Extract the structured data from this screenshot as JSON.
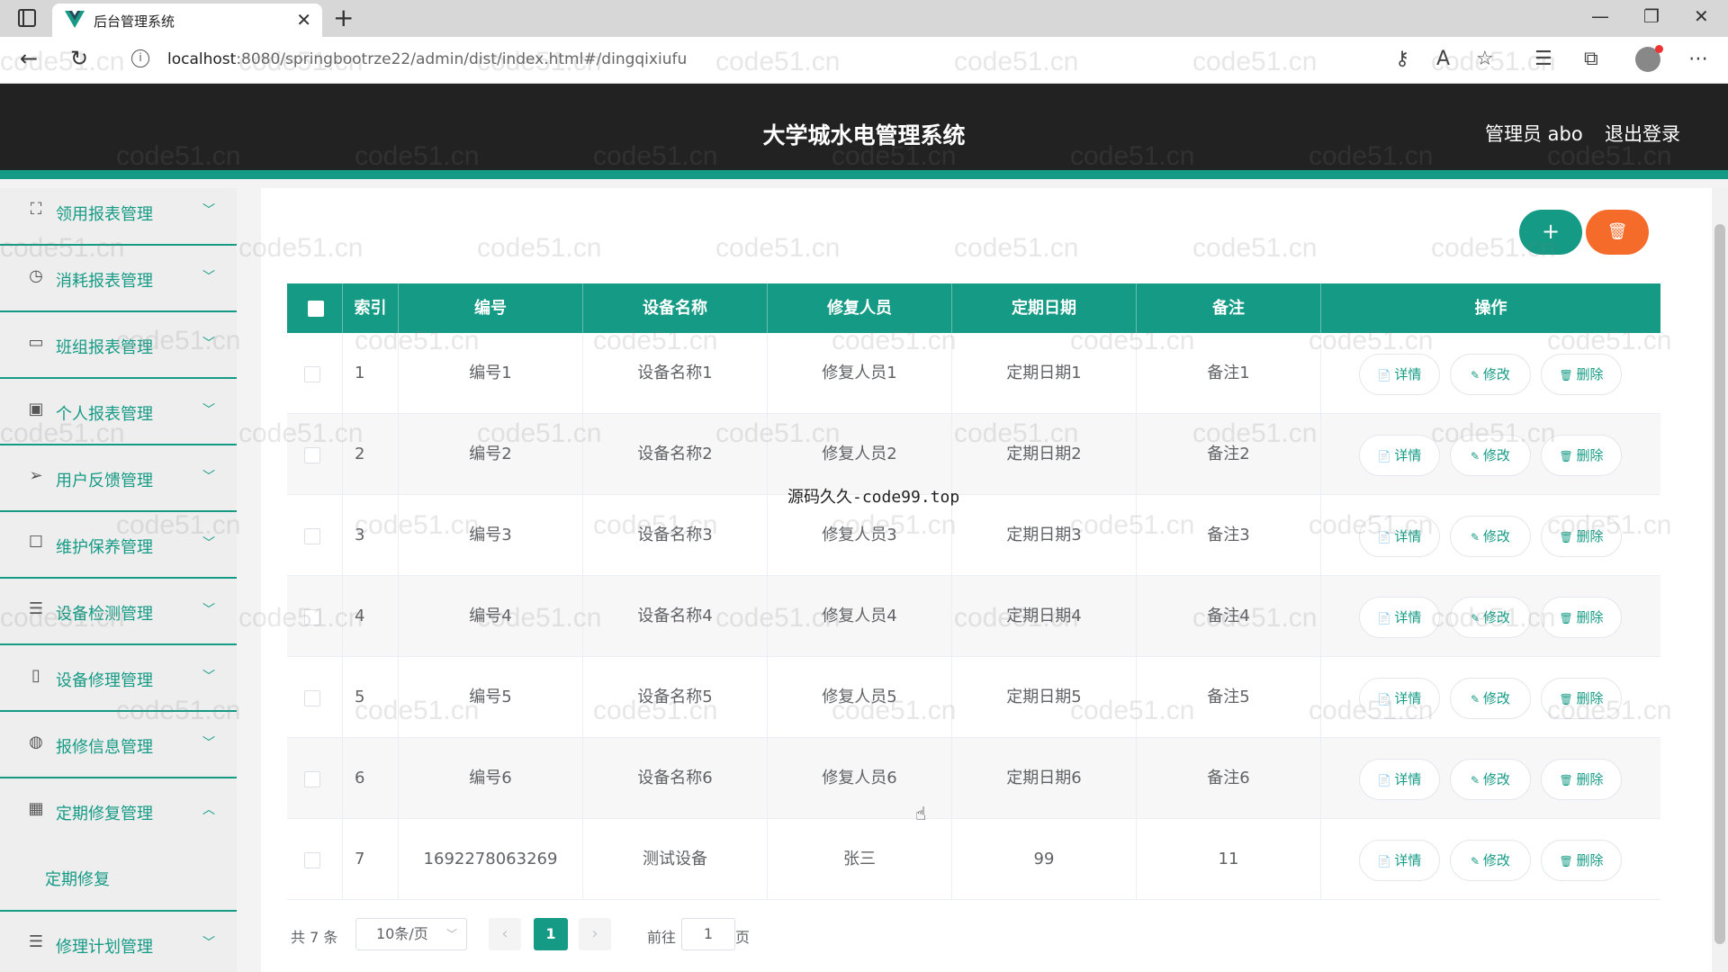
{
  "browser": {
    "tab_title": "后台管理系统",
    "url_host": "localhost",
    "url_path": ":8080/springbootrze22/admin/dist/index.html#/dingqixiufu"
  },
  "header": {
    "title": "大学城水电管理系统",
    "admin": "管理员 abo",
    "logout": "退出登录"
  },
  "sidebar": {
    "items": [
      {
        "label": "领用报表管理",
        "icon": "scan-icon"
      },
      {
        "label": "消耗报表管理",
        "icon": "clock-icon"
      },
      {
        "label": "班组报表管理",
        "icon": "card-icon"
      },
      {
        "label": "个人报表管理",
        "icon": "clipboard-icon"
      },
      {
        "label": "用户反馈管理",
        "icon": "send-icon"
      },
      {
        "label": "维护保养管理",
        "icon": "square-icon"
      },
      {
        "label": "设备检测管理",
        "icon": "list-icon"
      },
      {
        "label": "设备修理管理",
        "icon": "phone-icon"
      },
      {
        "label": "报修信息管理",
        "icon": "mic-icon"
      },
      {
        "label": "定期修复管理",
        "icon": "grid-icon"
      },
      {
        "label": "修理计划管理",
        "icon": "list-icon"
      }
    ],
    "submenu": "定期修复"
  },
  "table": {
    "headers": [
      "索引",
      "编号",
      "设备名称",
      "修复人员",
      "定期日期",
      "备注",
      "操作"
    ],
    "rows": [
      {
        "idx": "1",
        "code": "编号1",
        "name": "设备名称1",
        "person": "修复人员1",
        "date": "定期日期1",
        "note": "备注1"
      },
      {
        "idx": "2",
        "code": "编号2",
        "name": "设备名称2",
        "person": "修复人员2",
        "date": "定期日期2",
        "note": "备注2"
      },
      {
        "idx": "3",
        "code": "编号3",
        "name": "设备名称3",
        "person": "修复人员3",
        "date": "定期日期3",
        "note": "备注3"
      },
      {
        "idx": "4",
        "code": "编号4",
        "name": "设备名称4",
        "person": "修复人员4",
        "date": "定期日期4",
        "note": "备注4"
      },
      {
        "idx": "5",
        "code": "编号5",
        "name": "设备名称5",
        "person": "修复人员5",
        "date": "定期日期5",
        "note": "备注5"
      },
      {
        "idx": "6",
        "code": "编号6",
        "name": "设备名称6",
        "person": "修复人员6",
        "date": "定期日期6",
        "note": "备注6"
      },
      {
        "idx": "7",
        "code": "1692278063269",
        "name": "测试设备",
        "person": "张三",
        "date": "99",
        "note": "11"
      }
    ],
    "actions": {
      "detail": "详情",
      "edit": "修改",
      "delete": "删除"
    }
  },
  "pagination": {
    "total": "共 7 条",
    "page_size": "10条/页",
    "current": "1",
    "goto": "前往",
    "goto_value": "1",
    "page_suffix": "页"
  },
  "overlay": "源码久久-code99.top",
  "watermark": "code51.cn",
  "colors": {
    "primary": "#159b85",
    "danger": "#f56c2a",
    "header": "#222222"
  }
}
